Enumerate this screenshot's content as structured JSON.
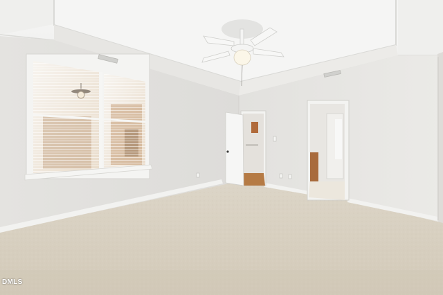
{
  "photo": {
    "subject": "empty-bedroom-interior",
    "features": [
      "tray-ceiling",
      "ceiling-fan",
      "window-with-blinds",
      "open-door",
      "doorway",
      "carpet",
      "hvac-vents",
      "outlets"
    ],
    "colors": {
      "wall": "#e6e5e2",
      "ceiling": "#f3f3f1",
      "carpet": "#d8d0c0",
      "trim": "#f1f1ef",
      "floor_wood": "#b57a44"
    }
  },
  "watermark": {
    "text": "DMLS"
  }
}
